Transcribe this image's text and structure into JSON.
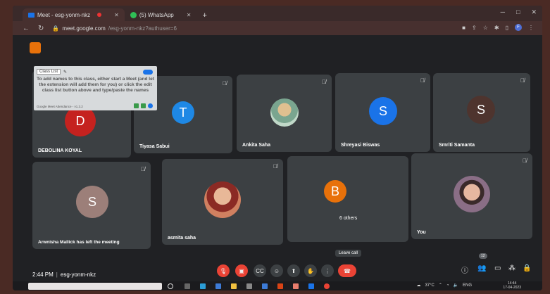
{
  "browser": {
    "tabs": [
      {
        "label": "Meet - esg-yonm-nkz",
        "icon": "meet-icon",
        "recording": true,
        "active": true
      },
      {
        "label": "(5) WhatsApp",
        "icon": "whatsapp-icon",
        "recording": false,
        "active": false
      }
    ],
    "url_host": "meet.google.com",
    "url_path": "/esg-yonm-nkz?authuser=6",
    "profile_initial": "F"
  },
  "extension_popup": {
    "select_label": "Class List",
    "message": "To add names to this class, either start a Meet (and let the extension will add them for you) or click the edit class list button above and type/paste the names",
    "footer": "Google Meet Attendance - v1.3.2"
  },
  "participants": [
    {
      "name": "DEBOLINA KOYAL",
      "initial": "D",
      "avatar_color": "#c5221f",
      "type": "initial"
    },
    {
      "name": "Tiyasa Sabui",
      "initial": "T",
      "avatar_color": "#1e88e5",
      "type": "initial"
    },
    {
      "name": "Ankita Saha",
      "initial": "",
      "avatar_color": "#7aa58f",
      "type": "photo"
    },
    {
      "name": "Shreyasi Biswas",
      "initial": "S",
      "avatar_color": "#1a73e8",
      "type": "initial"
    },
    {
      "name": "Smriti Samanta",
      "initial": "S",
      "avatar_color": "#4e342e",
      "type": "initial"
    },
    {
      "name": "Arwnisha Mallick has left the meeting",
      "initial": "S",
      "avatar_color": "#9c7f79",
      "type": "initial"
    },
    {
      "name": "asmita saha",
      "initial": "",
      "avatar_color": "#c97b5a",
      "type": "photo"
    },
    {
      "name": "6 others",
      "initial": "B",
      "avatar_color": "#e8710a",
      "type": "initial"
    },
    {
      "name": "You",
      "initial": "",
      "avatar_color": "#8a6e86",
      "type": "photo"
    }
  ],
  "meeting": {
    "time": "2:44 PM",
    "code": "esg-yonm-nkz",
    "leave_tooltip": "Leave call",
    "people_count": "12"
  },
  "taskbar": {
    "temperature": "37°C",
    "language": "ENG",
    "time": "14:44",
    "date": "17-04-2023"
  },
  "colors": {
    "meet_bg": "#202124",
    "tile_bg": "#3c4043",
    "danger": "#ea4335"
  }
}
